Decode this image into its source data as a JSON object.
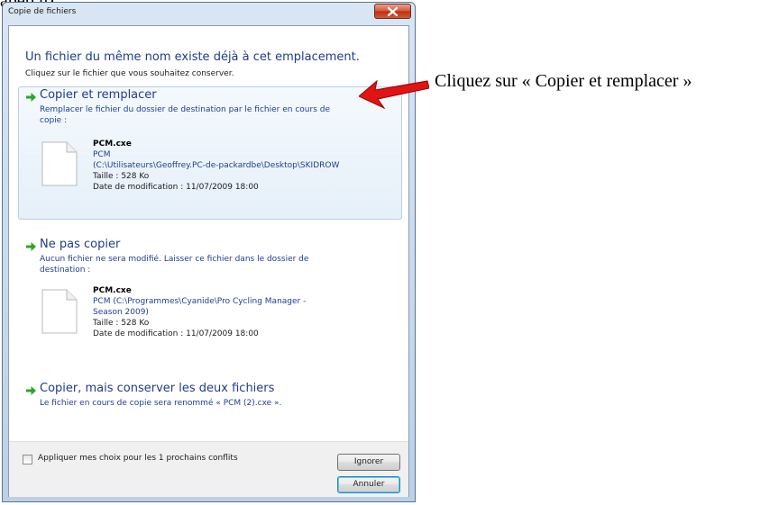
{
  "page": {
    "cut_heading": "aperçu)",
    "annotation": "Cliquez sur « Copier et remplacer »"
  },
  "dialog": {
    "title": "Copie de fichiers",
    "main_instruction": "Un fichier du même nom existe déjà à cet emplacement.",
    "sub_instruction": "Cliquez sur le fichier que vous souhaitez conserver.",
    "options": [
      {
        "title": "Copier et remplacer",
        "description_line1": "Remplacer le fichier du dossier de destination par le fichier en cours de",
        "description_line2": "copie :",
        "file": {
          "name": "PCM.cxe",
          "path_line1": "PCM",
          "path_line2": "(C:\\Utilisateurs\\Geoffrey.PC-de-packardbe\\Desktop\\SKIDROW",
          "size": "Taille : 528 Ko",
          "modified": "Date de modification : 11/07/2009 18:00"
        }
      },
      {
        "title": "Ne pas copier",
        "description_line1": "Aucun fichier ne sera modifié. Laisser ce fichier dans le dossier de",
        "description_line2": "destination :",
        "file": {
          "name": "PCM.cxe",
          "path_line1": "PCM (C:\\Programmes\\Cyanide\\Pro Cycling Manager -",
          "path_line2": "Season 2009)",
          "size": "Taille : 528 Ko",
          "modified": "Date de modification : 11/07/2009 18:00"
        }
      },
      {
        "title": "Copier, mais conserver les deux fichiers",
        "description_line1": "Le fichier en cours de copie sera renommé « PCM (2).cxe »."
      }
    ],
    "footer": {
      "checkbox_label": "Appliquer mes choix pour les 1 prochains conflits",
      "checkbox_checked": false,
      "skip_button": "Ignorer",
      "cancel_button": "Annuler"
    }
  },
  "colors": {
    "instruction_blue": "#1e3c8c",
    "arrow_green": "#2aa52a",
    "annotation_arrow_red": "#e01414",
    "close_button_red": "#c8401e"
  },
  "icons": [
    "green-arrow-icon",
    "file-icon",
    "close-icon",
    "red-arrow-icon"
  ]
}
